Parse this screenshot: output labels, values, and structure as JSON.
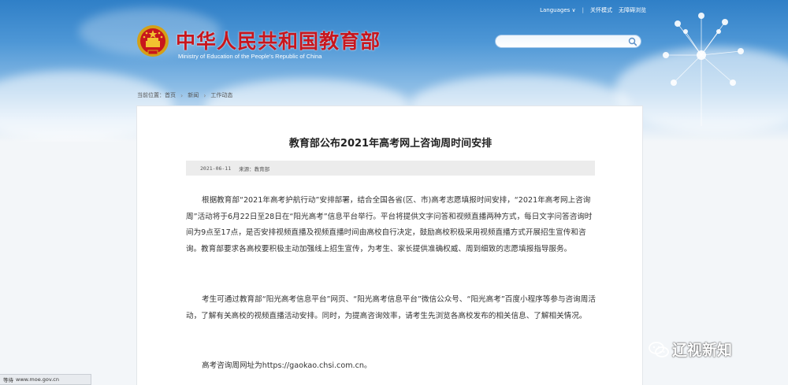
{
  "header": {
    "top_links": {
      "languages": "Languages ∨",
      "caring": "关怀模式",
      "accessible": "无障碍浏览"
    },
    "title": "中华人民共和国教育部",
    "subtitle": "Ministry of Education of the People's Republic of China",
    "search": {
      "placeholder": "",
      "value": ""
    }
  },
  "breadcrumb": {
    "prefix": "当前位置：首页",
    "items": [
      "新闻",
      "工作动态"
    ]
  },
  "article": {
    "title": "教育部公布2021年高考网上咨询周时间安排",
    "date": "2021-06-11",
    "source": "来源：教育部",
    "paragraphs": [
      "根据教育部“2021年高考护航行动”安排部署，结合全国各省(区、市)高考志愿填报时间安排，“2021年高考网上咨询周”活动将于6月22日至28日在“阳光高考”信息平台举行。平台将提供文字问答和视频直播两种方式，每日文字问答咨询时间为9点至17点，是否安排视频直播及视频直播时间由高校自行决定，鼓励高校积极采用视频直播方式开展招生宣传和咨询。教育部要求各高校要积极主动加强线上招生宣传，为考生、家长提供准确权威、周到细致的志愿填报指导服务。",
      "考生可通过教育部“阳光高考信息平台”网页、“阳光高考信息平台”微信公众号、“阳光高考”百度小程序等参与咨询周活动，了解有关高校的视频直播活动安排。同时，为提高咨询效率，请考生先浏览各高校发布的相关信息、了解相关情况。",
      "高考咨询周网址为https://gaokao.chsi.com.cn。"
    ]
  },
  "watermark": {
    "text": "辽视新知"
  },
  "status_bar": {
    "state": "等待",
    "url": "www.moe.gov.cn"
  },
  "colors": {
    "title_red": "#c8161d",
    "sky_top": "#2f7fc7"
  }
}
